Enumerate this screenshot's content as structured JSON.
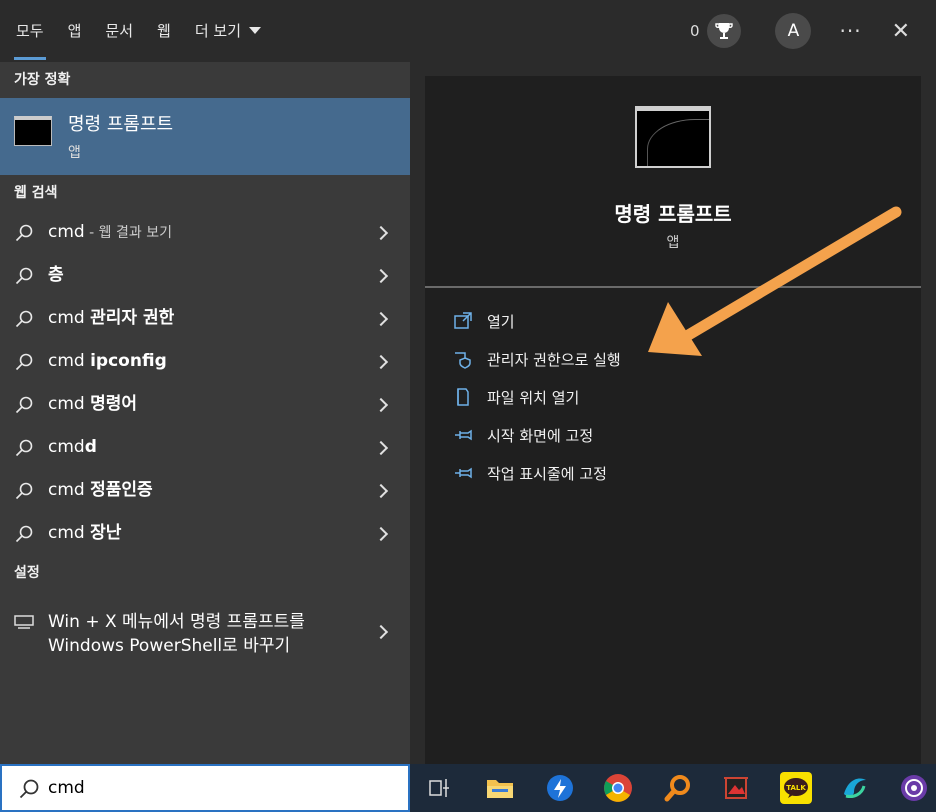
{
  "top": {
    "tabs": [
      "모두",
      "앱",
      "문서",
      "웹",
      "더 보기"
    ],
    "points": "0",
    "avatar": "A",
    "more": "···",
    "close": "✕"
  },
  "left": {
    "best_match_title": "가장 정확",
    "best": {
      "name": "명령 프롬프트",
      "type": "앱"
    },
    "web_title": "웹 검색",
    "web": [
      {
        "plain": "cmd",
        "bold": "",
        "dim": " - 웹 결과 보기"
      },
      {
        "plain": "",
        "bold": "층",
        "dim": ""
      },
      {
        "plain": "cmd ",
        "bold": "관리자 권한",
        "dim": ""
      },
      {
        "plain": "cmd ",
        "bold": "ipconfig",
        "dim": ""
      },
      {
        "plain": "cmd ",
        "bold": "명령어",
        "dim": ""
      },
      {
        "plain": "cmd",
        "bold": "d",
        "dim": ""
      },
      {
        "plain": "cmd ",
        "bold": "정품인증",
        "dim": ""
      },
      {
        "plain": "cmd ",
        "bold": "장난",
        "dim": ""
      }
    ],
    "settings_title": "설정",
    "setting": {
      "line1": "Win + X 메뉴에서 명령 프롬프트를",
      "line2": "Windows PowerShell로 바꾸기"
    }
  },
  "right": {
    "title": "명령 프롬프트",
    "subtitle": "앱",
    "actions": [
      "열기",
      "관리자 권한으로 실행",
      "파일 위치 열기",
      "시작 화면에 고정",
      "작업 표시줄에 고정"
    ],
    "arrow_color": "#f4a24c"
  },
  "search": {
    "value": "cmd"
  },
  "taskbar": {
    "items": [
      "task-view-icon",
      "file-explorer-icon",
      "blue-app-icon",
      "chrome-icon",
      "search-app-icon",
      "photo-app-icon",
      "kakaotalk-icon",
      "browser-app-icon",
      "purple-app-icon"
    ],
    "kakao_label": "TALK"
  },
  "colors": {
    "accent": "#5b9bd5",
    "selected": "#456a8e",
    "search_border": "#2a72c2"
  }
}
